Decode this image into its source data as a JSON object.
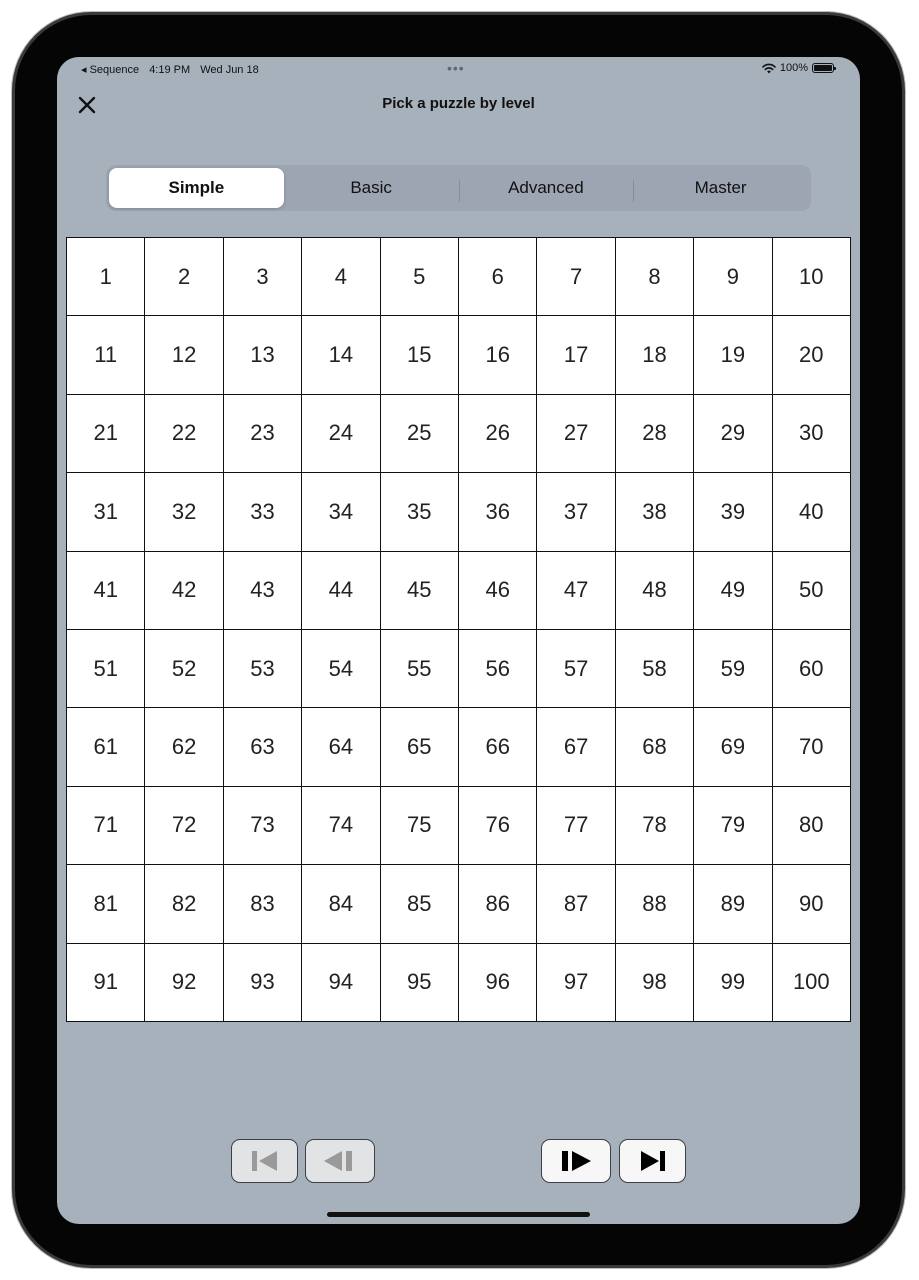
{
  "status_bar": {
    "back_app": "◂ Sequence",
    "time": "4:19 PM",
    "date": "Wed Jun 18",
    "multitask_dots": "•••",
    "battery": "100%"
  },
  "header": {
    "close_icon": "xmark",
    "title": "Pick a puzzle by level"
  },
  "levels": {
    "selected": "Simple",
    "items": [
      "Simple",
      "Basic",
      "Advanced",
      "Master"
    ]
  },
  "puzzles": [
    "1",
    "2",
    "3",
    "4",
    "5",
    "6",
    "7",
    "8",
    "9",
    "10",
    "11",
    "12",
    "13",
    "14",
    "15",
    "16",
    "17",
    "18",
    "19",
    "20",
    "21",
    "22",
    "23",
    "24",
    "25",
    "26",
    "27",
    "28",
    "29",
    "30",
    "31",
    "32",
    "33",
    "34",
    "35",
    "36",
    "37",
    "38",
    "39",
    "40",
    "41",
    "42",
    "43",
    "44",
    "45",
    "46",
    "47",
    "48",
    "49",
    "50",
    "51",
    "52",
    "53",
    "54",
    "55",
    "56",
    "57",
    "58",
    "59",
    "60",
    "61",
    "62",
    "63",
    "64",
    "65",
    "66",
    "67",
    "68",
    "69",
    "70",
    "71",
    "72",
    "73",
    "74",
    "75",
    "76",
    "77",
    "78",
    "79",
    "80",
    "81",
    "82",
    "83",
    "84",
    "85",
    "86",
    "87",
    "88",
    "89",
    "90",
    "91",
    "92",
    "93",
    "94",
    "95",
    "96",
    "97",
    "98",
    "99",
    "100"
  ],
  "pager": {
    "first_icon": "skip-to-start-icon",
    "prev_icon": "step-back-icon",
    "next_icon": "step-forward-icon",
    "last_icon": "skip-to-end-icon",
    "disabled_color": "#9a9a9a",
    "enabled_color": "#000000"
  }
}
